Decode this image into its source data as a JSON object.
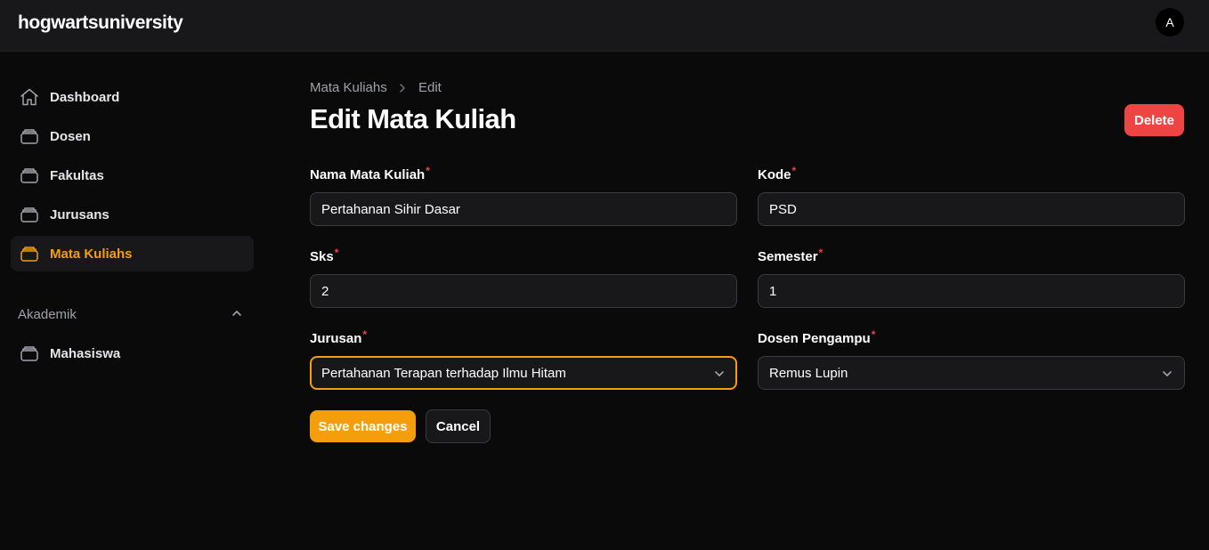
{
  "app": {
    "brand": "hogwartsuniversity",
    "avatar_initial": "A"
  },
  "colors": {
    "accent": "#f59e0b",
    "danger": "#ef4444",
    "background": "#0a0a0b",
    "surface": "#18181b"
  },
  "sidebar": {
    "items": [
      {
        "label": "Dashboard",
        "icon": "home-icon",
        "active": false
      },
      {
        "label": "Dosen",
        "icon": "stack-icon",
        "active": false
      },
      {
        "label": "Fakultas",
        "icon": "stack-icon",
        "active": false
      },
      {
        "label": "Jurusans",
        "icon": "stack-icon",
        "active": false
      },
      {
        "label": "Mata Kuliahs",
        "icon": "stack-icon",
        "active": true
      }
    ],
    "group": {
      "label": "Akademik",
      "expanded": true,
      "items": [
        {
          "label": "Mahasiswa",
          "icon": "stack-icon",
          "active": false
        }
      ]
    }
  },
  "breadcrumb": {
    "parent": "Mata Kuliahs",
    "current": "Edit"
  },
  "page": {
    "title": "Edit Mata Kuliah",
    "delete_label": "Delete"
  },
  "form": {
    "required_marker": "*",
    "nama": {
      "label": "Nama Mata Kuliah",
      "value": "Pertahanan Sihir Dasar"
    },
    "kode": {
      "label": "Kode",
      "value": "PSD"
    },
    "sks": {
      "label": "Sks",
      "value": "2"
    },
    "semester": {
      "label": "Semester",
      "value": "1"
    },
    "jurusan": {
      "label": "Jurusan",
      "value": "Pertahanan Terapan terhadap Ilmu Hitam"
    },
    "dosen": {
      "label": "Dosen Pengampu",
      "value": "Remus Lupin"
    },
    "save_label": "Save changes",
    "cancel_label": "Cancel"
  }
}
